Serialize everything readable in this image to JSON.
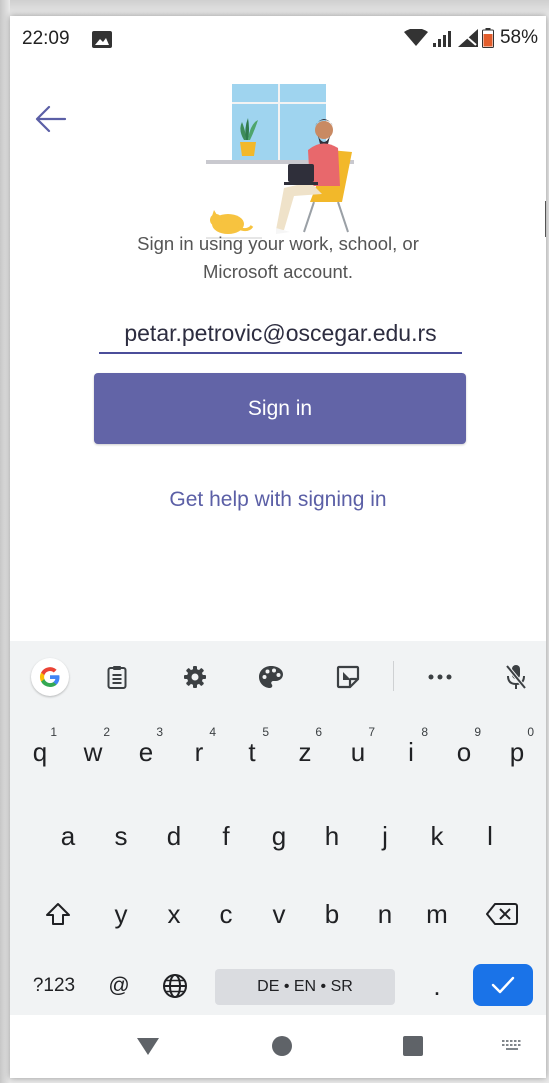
{
  "status_bar": {
    "time": "22:09",
    "battery_percent": "58%",
    "icons": [
      "image-icon",
      "wifi-icon",
      "signal-icon",
      "no-signal-icon",
      "battery-icon"
    ]
  },
  "signin": {
    "back_icon": "arrow-left-icon",
    "description": "Sign in using your work, school, or Microsoft account.",
    "email_value": "petar.petrovic@oscegar.edu.rs",
    "sign_in_label": "Sign in",
    "help_label": "Get help with signing in",
    "accent_color": "#6264a7"
  },
  "keyboard": {
    "toolbar": [
      "google-icon",
      "clipboard-icon",
      "gear-icon",
      "palette-icon",
      "sticker-icon",
      "more-icon",
      "mic-off-icon"
    ],
    "row1": [
      {
        "key": "q",
        "hint": "1"
      },
      {
        "key": "w",
        "hint": "2"
      },
      {
        "key": "e",
        "hint": "3"
      },
      {
        "key": "r",
        "hint": "4"
      },
      {
        "key": "t",
        "hint": "5"
      },
      {
        "key": "z",
        "hint": "6"
      },
      {
        "key": "u",
        "hint": "7"
      },
      {
        "key": "i",
        "hint": "8"
      },
      {
        "key": "o",
        "hint": "9"
      },
      {
        "key": "p",
        "hint": "0"
      }
    ],
    "row2": [
      "a",
      "s",
      "d",
      "f",
      "g",
      "h",
      "j",
      "k",
      "l"
    ],
    "row3": [
      "y",
      "x",
      "c",
      "v",
      "b",
      "n",
      "m"
    ],
    "symbols_label": "?123",
    "at_label": "@",
    "space_label": "DE • EN • SR",
    "period_label": ".",
    "enter_color": "#1a73e8"
  },
  "nav_bar": {
    "icons": [
      "back-triangle-icon",
      "home-circle-icon",
      "recents-square-icon",
      "keyboard-switch-icon"
    ]
  }
}
